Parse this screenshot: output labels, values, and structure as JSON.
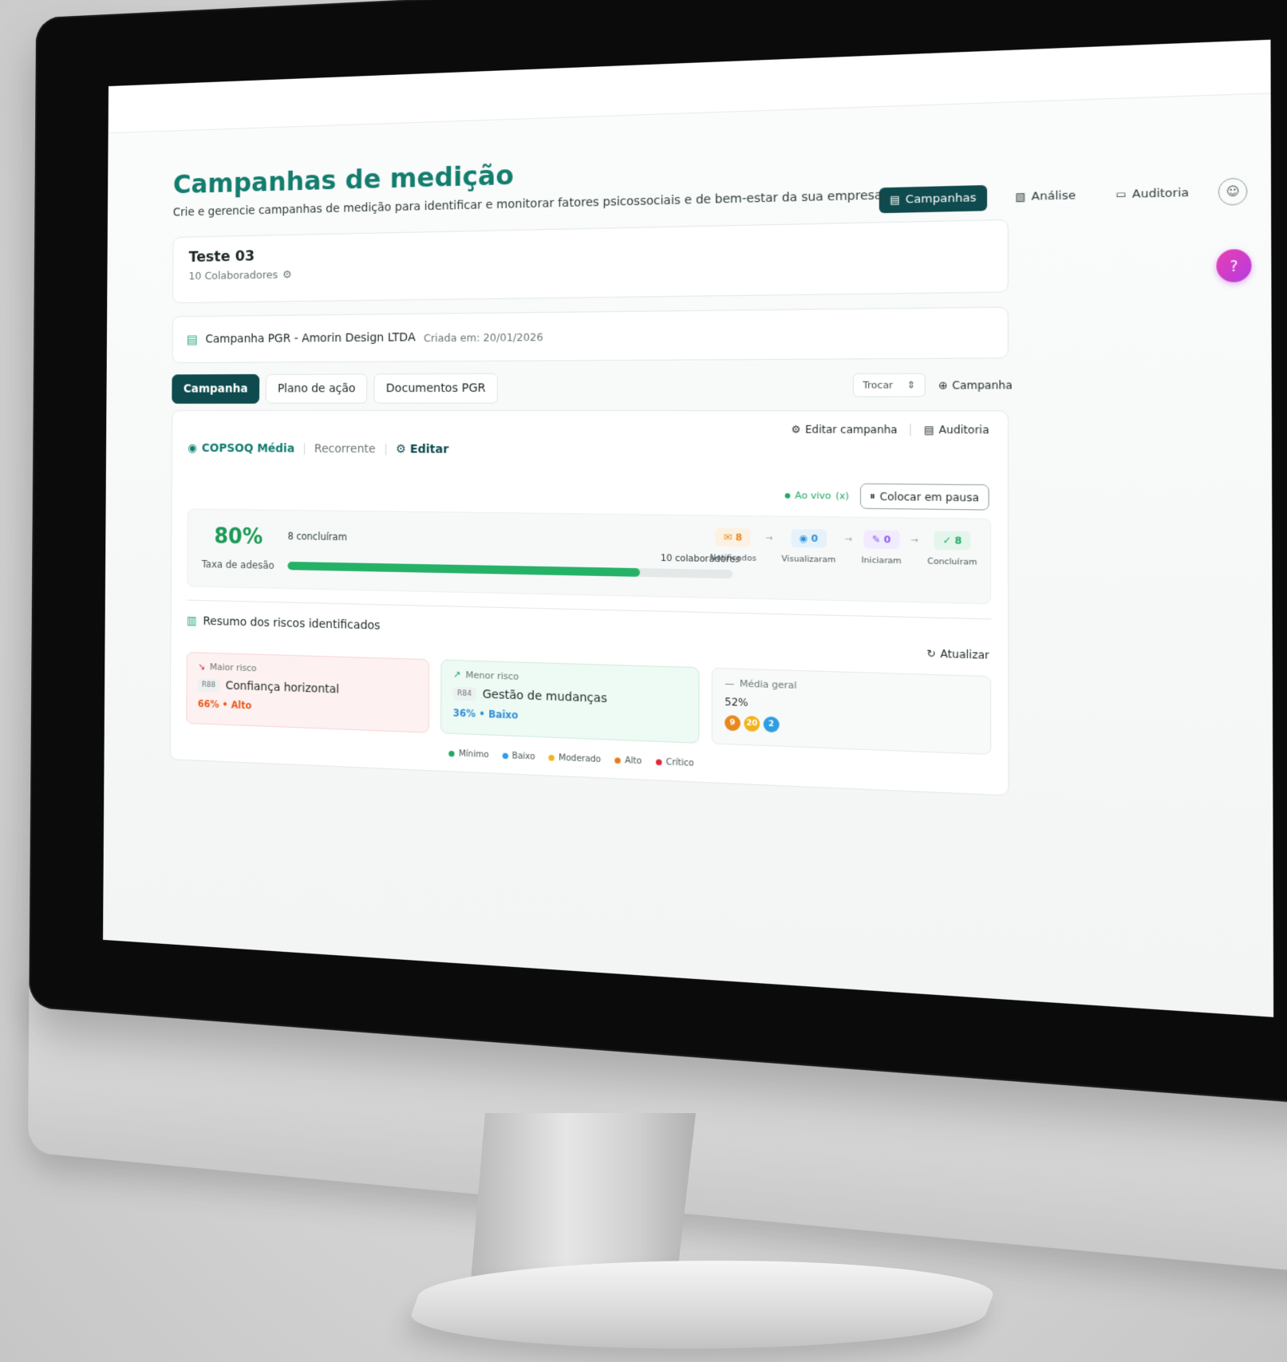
{
  "nav": {
    "items": [
      {
        "label": "Campanhas",
        "icon": "clipboard-icon",
        "active": true
      },
      {
        "label": "Análise",
        "icon": "document-icon",
        "active": false
      },
      {
        "label": "Auditoria",
        "icon": "folder-icon",
        "active": false
      }
    ]
  },
  "header": {
    "title": "Campanhas de medição",
    "subtitle": "Crie e gerencie campanhas de medição para identificar e monitorar fatores psicossociais e de bem-estar da sua empresa."
  },
  "team": {
    "name": "Teste 03",
    "collaborators": "10 Colaboradores"
  },
  "campaign": {
    "name": "Campanha PGR - Amorin Design LTDA",
    "created": "Criada em: 20/01/2026"
  },
  "tabs": [
    "Campanha",
    "Plano de ação",
    "Documentos PGR"
  ],
  "switcher": {
    "label": "Trocar",
    "add_label": "Campanha"
  },
  "main": {
    "edit_campaign": "Editar campanha",
    "audit": "Auditoria",
    "method": "COPSOQ Média",
    "frequency": "Recorrente",
    "edit": "Editar",
    "live": "Ao vivo",
    "live_count": "(x)",
    "pause": "Colocar em pausa"
  },
  "stats": {
    "adhesion_value": "80%",
    "adhesion_label": "Taxa de adesão",
    "concluded_label": "8 concluíram",
    "collaborators_label": "10 colaboradores",
    "progress": 0.8,
    "funnel": [
      {
        "value": "8",
        "label": "Notificados",
        "icon": "mail-icon",
        "color": "#e8871e",
        "bg": "#fdf1e2"
      },
      {
        "value": "0",
        "label": "Visualizaram",
        "icon": "eye-icon",
        "color": "#2f8fd8",
        "bg": "#e6f2fb"
      },
      {
        "value": "0",
        "label": "Iniciaram",
        "icon": "pencil-icon",
        "color": "#8b5cf6",
        "bg": "#f1ebfd"
      },
      {
        "value": "8",
        "label": "Concluíram",
        "icon": "check-circle-icon",
        "color": "#1fa864",
        "bg": "#e4f6ec"
      }
    ]
  },
  "risks": {
    "title": "Resumo dos riscos identificados",
    "refresh": "Atualizar",
    "highest": {
      "kind": "Maior risco",
      "code": "R88",
      "name": "Confiança horizontal",
      "value": "66% • Alto",
      "color": "#ea5a1c"
    },
    "lowest": {
      "kind": "Menor risco",
      "code": "R84",
      "name": "Gestão de mudanças",
      "value": "36% • Baixo",
      "color": "#2f8fd8"
    },
    "average": {
      "kind": "Média geral",
      "value": "52%",
      "badges": [
        {
          "value": "9",
          "color": "#e8871e"
        },
        {
          "value": "20",
          "color": "#f2b21b"
        },
        {
          "value": "2",
          "color": "#2f9ee0"
        }
      ]
    }
  },
  "legend": [
    {
      "label": "Mínimo",
      "color": "#1fa864"
    },
    {
      "label": "Baixo",
      "color": "#2f9ee0"
    },
    {
      "label": "Moderado",
      "color": "#f2b21b"
    },
    {
      "label": "Alto",
      "color": "#ea7a1c"
    },
    {
      "label": "Crítico",
      "color": "#e0283c"
    }
  ]
}
